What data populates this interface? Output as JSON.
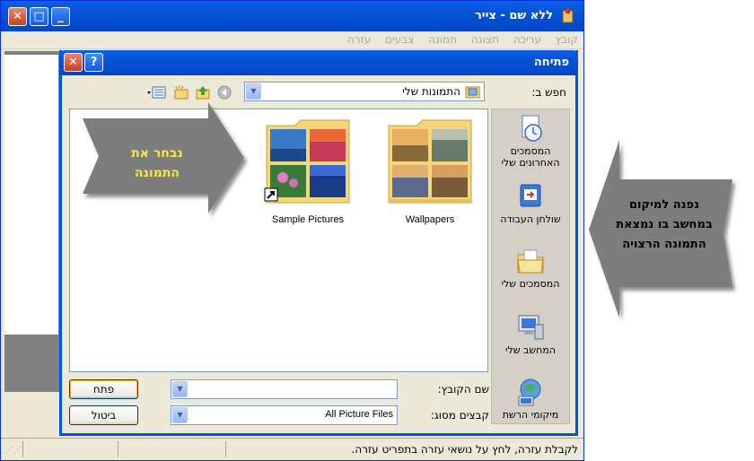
{
  "paint": {
    "title": "ללא שם - צייר",
    "menu": [
      "קובץ",
      "עריכה",
      "תצוגה",
      "תמונה",
      "צבעים",
      "עזרה"
    ],
    "status": "לקבלת עזרה, לחץ על נושאי עזרה בתפריט עזרה."
  },
  "dialog": {
    "title": "פתיחה",
    "look_in_label": "חפש ב:",
    "look_in_value": "התמונות שלי",
    "places": [
      {
        "label": "המסמכים האחרונים שלי",
        "icon": "recent-documents-icon"
      },
      {
        "label": "שולחן העבודה",
        "icon": "desktop-icon"
      },
      {
        "label": "המסמכים שלי",
        "icon": "my-documents-icon"
      },
      {
        "label": "המחשב שלי",
        "icon": "my-computer-icon"
      },
      {
        "label": "מיקומי הרשת",
        "icon": "network-places-icon"
      }
    ],
    "files": [
      {
        "name": "Wallpapers",
        "icon": "folder-icon"
      },
      {
        "name": "Sample Pictures",
        "icon": "folder-shortcut-icon"
      }
    ],
    "file_name_label": "שם הקובץ:",
    "file_name_value": "",
    "file_type_label": "קבצים מסוג:",
    "file_type_value": "All Picture Files",
    "open_button": "פתח",
    "cancel_button": "ביטול"
  },
  "callouts": {
    "left": "נבחר את התמונה",
    "right": "נפנה למיקום במחשב בו נמצאת התמונה הרצויה"
  },
  "colors": {
    "xp_blue": "#0054e3",
    "dialog_bg": "#ece9d8",
    "arrow_gray": "#7d7d7d",
    "callout_yellow": "#f5e84a"
  }
}
